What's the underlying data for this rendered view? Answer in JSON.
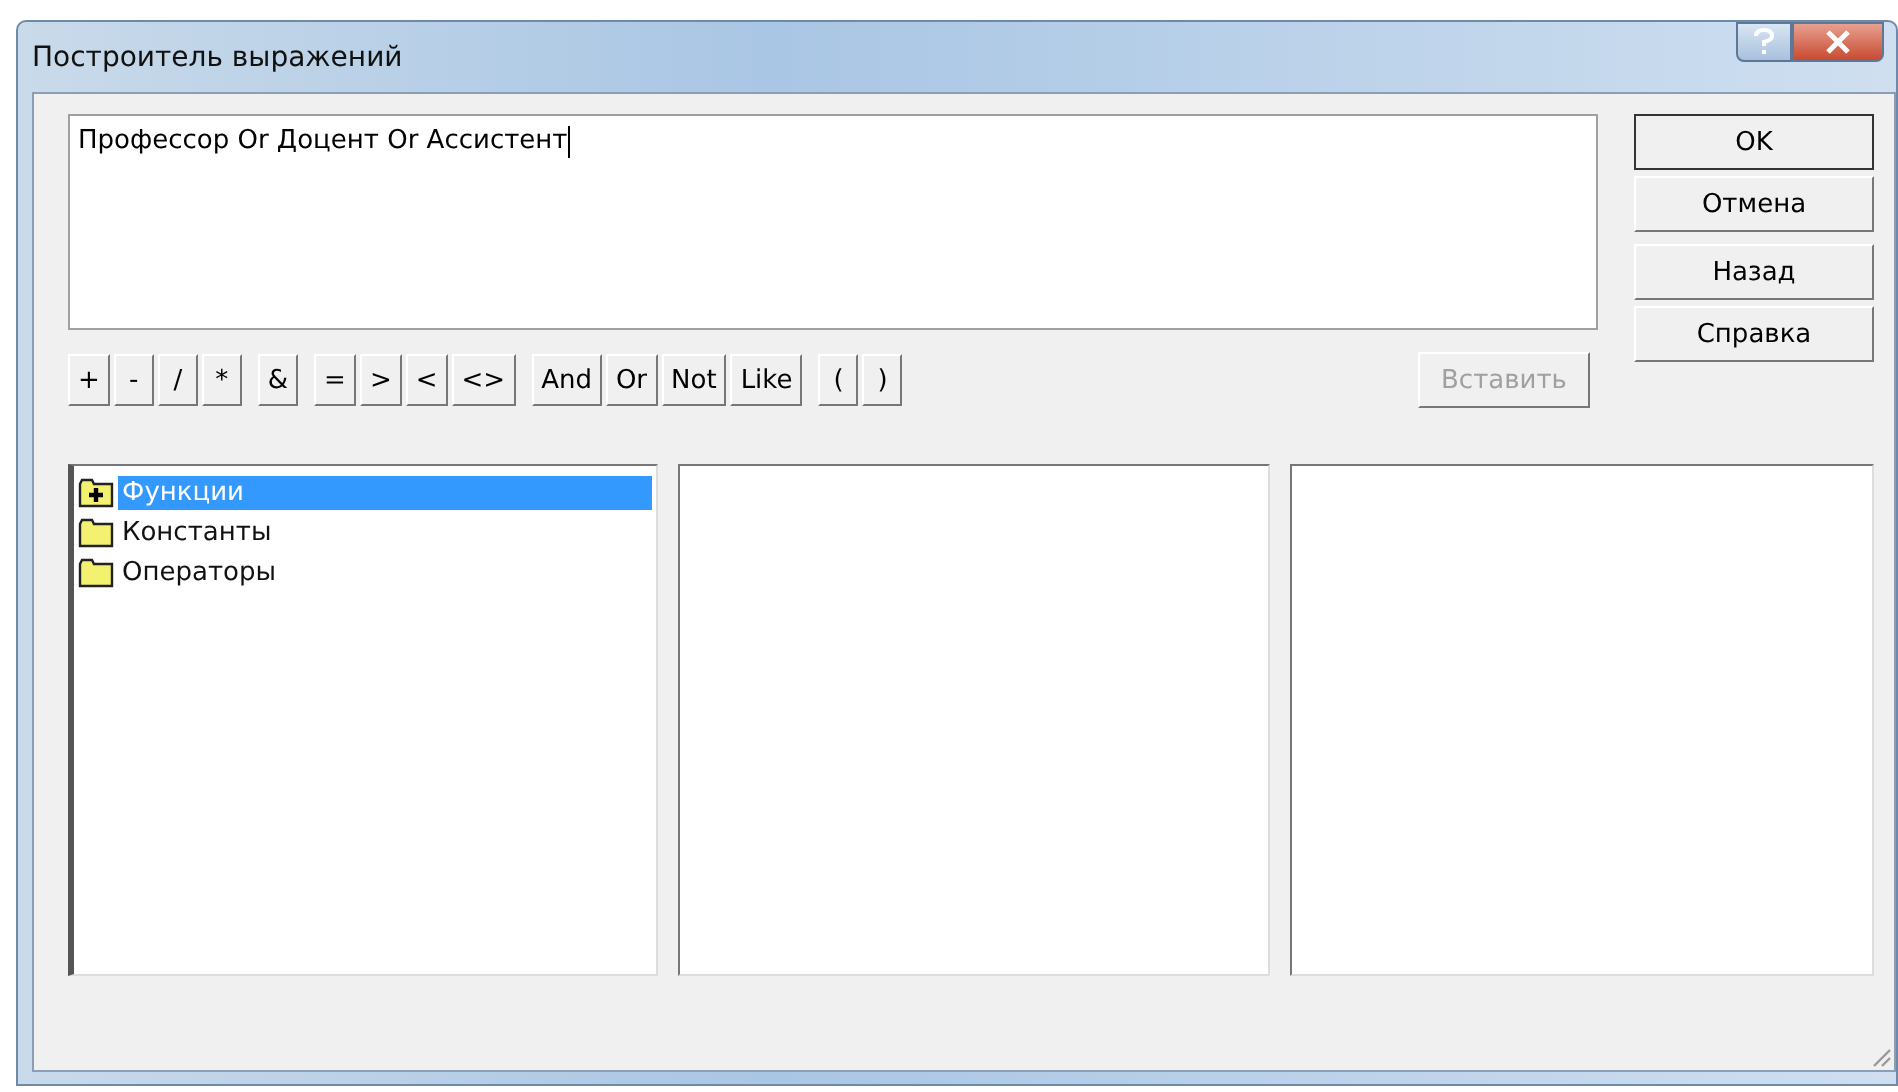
{
  "window": {
    "title": "Построитель выражений"
  },
  "expression": {
    "value": "Профессор Or Доцент Or Ассистент"
  },
  "operator_groups": [
    [
      "+",
      "-",
      "/",
      "*"
    ],
    [
      "&"
    ],
    [
      "=",
      ">",
      "<",
      "<>"
    ],
    [
      "And",
      "Or",
      "Not",
      "Like"
    ],
    [
      "(",
      ")"
    ]
  ],
  "paste_button": {
    "label": "Вставить",
    "disabled": true
  },
  "side_buttons": [
    "OK",
    "Отмена",
    "Назад",
    "Справка"
  ],
  "tree": [
    {
      "label": "Функции",
      "selected": true,
      "expandable": true
    },
    {
      "label": "Константы",
      "selected": false,
      "expandable": false
    },
    {
      "label": "Операторы",
      "selected": false,
      "expandable": false
    }
  ]
}
